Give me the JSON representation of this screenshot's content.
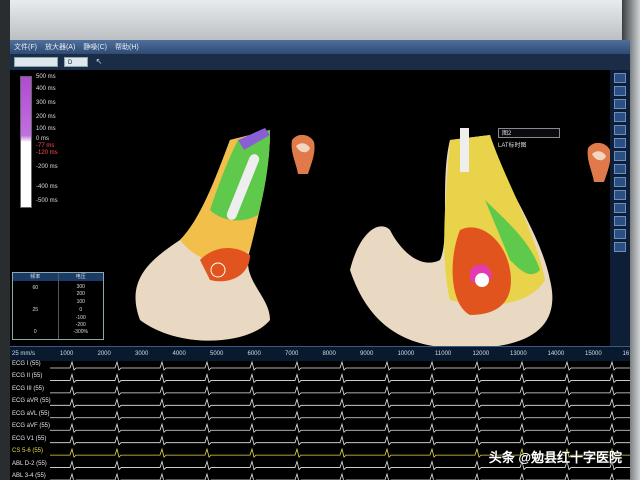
{
  "menu": [
    "文件(F)",
    "放大器(A)",
    "静噪(C)",
    "帮助(H)"
  ],
  "toolbar": {
    "map_select": "",
    "dd2": "D"
  },
  "scale": {
    "labels": [
      "500 ms",
      "400 ms",
      "300 ms",
      "200 ms",
      "100 ms",
      "0 ms",
      "-77 ms",
      "-120 ms",
      "-200 ms",
      "-400 ms",
      "-500 ms"
    ]
  },
  "legend": {
    "col1": {
      "header": "频率",
      "values": [
        "60",
        "25",
        "0"
      ]
    },
    "col2": {
      "header": "电压",
      "values": [
        "300",
        "200",
        "100",
        "0",
        "-100",
        "-200",
        "-300%"
      ]
    }
  },
  "lat": {
    "select": "图2",
    "label": "LAT标时图"
  },
  "ruler": {
    "speed": "25 mm/s",
    "ticks": [
      "1000",
      "2000",
      "3000",
      "4000",
      "5000",
      "6000",
      "7000",
      "8000",
      "9000",
      "10000",
      "11000",
      "12000",
      "13000",
      "14000",
      "15000",
      "16"
    ]
  },
  "ecg_leads": [
    {
      "name": "ECG I (55)",
      "color": "#e8e8e8"
    },
    {
      "name": "ECG II (55)",
      "color": "#e8e8e8"
    },
    {
      "name": "ECG III (55)",
      "color": "#e8e8e8"
    },
    {
      "name": "ECG aVR (55)",
      "color": "#e8e8e8"
    },
    {
      "name": "ECG aVL (55)",
      "color": "#e8e8e8"
    },
    {
      "name": "ECG aVF (55)",
      "color": "#e8e8e8"
    },
    {
      "name": "ECG V1 (55)",
      "color": "#e8e8e8"
    },
    {
      "name": "CS 5-6 (55)",
      "color": "#e8d84a"
    },
    {
      "name": "ABL D-2 (55)",
      "color": "#e8e8e8"
    },
    {
      "name": "ABL 3-4 (55)",
      "color": "#e8e8e8"
    }
  ],
  "watermark": "头条 @勉县红十字医院"
}
